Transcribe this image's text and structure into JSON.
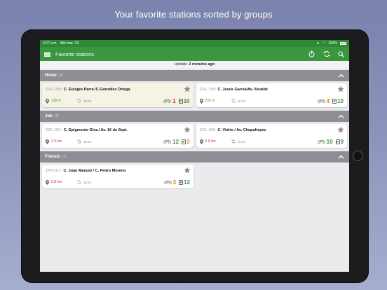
{
  "promo_caption": "Your favorite stations sorted by groups",
  "status_bar": {
    "time": "4:27 p.m.",
    "date": "Mié mar. 23",
    "battery": "100%"
  },
  "app_bar": {
    "title": "Favorite stations",
    "menu_icon": "hamburger-menu-icon",
    "timer_icon": "stopwatch-icon",
    "refresh_icon": "refresh-icon",
    "search_icon": "search-icon",
    "color": "#3a963f"
  },
  "update": {
    "label": "Update:",
    "value": "2 minutes ago"
  },
  "parking_symbol": "P",
  "groups": [
    {
      "name": "Home",
      "count": "(2)",
      "stations": [
        {
          "code": "GDL-099:",
          "name": "C. Eulogio Parra /C.González Ortega",
          "distance": "138 m",
          "distance_color": "green",
          "time": "16:26",
          "bikes": "1",
          "bikes_color": "red",
          "parking": "10",
          "parking_color": "green",
          "highlighted": true
        },
        {
          "code": "GDL-199:",
          "name": "C. Jesús García/Av. Alcalde",
          "distance": "233 m",
          "distance_color": "green",
          "time": "16:23",
          "bikes": "4",
          "bikes_color": "orange",
          "parking": "10",
          "parking_color": "green",
          "highlighted": false
        }
      ]
    },
    {
      "name": "Job",
      "count": "(2)",
      "stations": [
        {
          "code": "GDL-001:",
          "name": "C. Epigmenio Glez./ Av. 16 de Sept.",
          "distance": "2.3 km",
          "distance_color": "red",
          "time": "16:24",
          "bikes": "12",
          "bikes_color": "green",
          "parking": "3",
          "parking_color": "orange",
          "highlighted": false
        },
        {
          "code": "GDL-003:",
          "name": "C. Vidrio / Av. Chapultepec",
          "distance": "2.9 km",
          "distance_color": "red",
          "time": "16:21",
          "bikes": "10",
          "bikes_color": "green",
          "parking": "9",
          "parking_color": "green",
          "highlighted": false
        }
      ]
    },
    {
      "name": "Friends",
      "count": "(1)",
      "stations": [
        {
          "code": "ZPN-017:",
          "name": "C. Juan Manuel / C. Pedro Moreno",
          "distance": "5.8 km",
          "distance_color": "red",
          "time": "16:24",
          "bikes": "3",
          "bikes_color": "orange",
          "parking": "12",
          "parking_color": "green",
          "highlighted": false
        }
      ]
    }
  ]
}
